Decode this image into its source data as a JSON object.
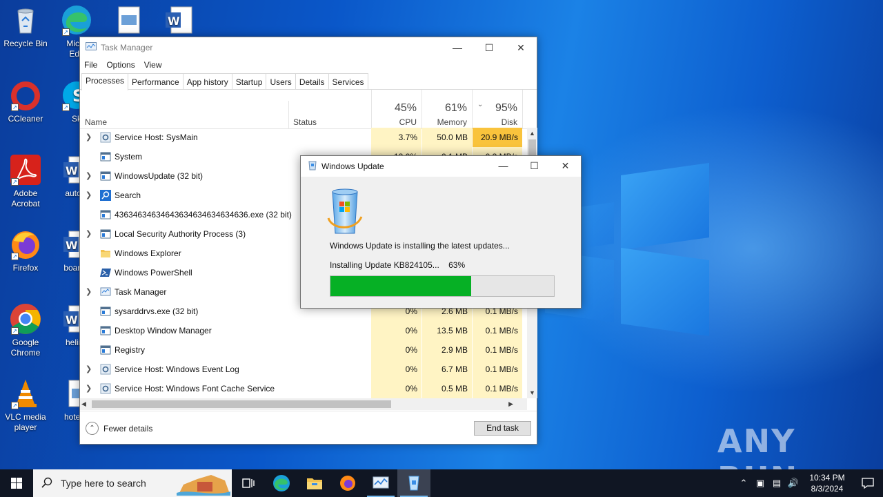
{
  "desktop": {
    "icons": [
      {
        "label": "Recycle Bin",
        "icon": "recycle-bin-icon"
      },
      {
        "label": "Micro Edg",
        "icon": "edge-icon"
      },
      {
        "label": "CCleaner",
        "icon": "ccleaner-icon"
      },
      {
        "label": "Sky",
        "icon": "skype-icon"
      },
      {
        "label": "Adobe Acrobat",
        "icon": "acrobat-icon"
      },
      {
        "label": "autom",
        "icon": "word-doc-icon"
      },
      {
        "label": "Firefox",
        "icon": "firefox-icon"
      },
      {
        "label": "boardp",
        "icon": "word-doc-icon"
      },
      {
        "label": "Google Chrome",
        "icon": "chrome-icon"
      },
      {
        "label": "helinu",
        "icon": "word-doc-icon"
      },
      {
        "label": "VLC media player",
        "icon": "vlc-icon"
      },
      {
        "label": "hotelte",
        "icon": "image-file-icon"
      }
    ],
    "watermark": "ANY RUN"
  },
  "task_manager": {
    "title": "Task Manager",
    "menu": [
      "File",
      "Options",
      "View"
    ],
    "tabs": [
      "Processes",
      "Performance",
      "App history",
      "Startup",
      "Users",
      "Details",
      "Services"
    ],
    "active_tab": "Processes",
    "columns": {
      "name": "Name",
      "status": "Status",
      "cpu_pct": "45%",
      "cpu": "CPU",
      "mem_pct": "61%",
      "mem": "Memory",
      "disk_pct": "95%",
      "disk": "Disk"
    },
    "processes": [
      {
        "name": "Service Host: SysMain",
        "expand": true,
        "icon": "gear-icon",
        "cpu": "3.7%",
        "mem": "50.0 MB",
        "disk": "20.9 MB/s",
        "disk_hot": true
      },
      {
        "name": "System",
        "expand": false,
        "icon": "window-icon",
        "cpu": "13.0%",
        "mem": "0.1 MB",
        "disk": "0.3 MB/s"
      },
      {
        "name": "WindowsUpdate (32 bit)",
        "expand": true,
        "icon": "window-icon",
        "cpu": "",
        "mem": "",
        "disk": ""
      },
      {
        "name": "Search",
        "expand": true,
        "icon": "search-icon",
        "cpu": "",
        "mem": "",
        "disk": ""
      },
      {
        "name": "43634634634643634634634634636.exe (32 bit)",
        "expand": false,
        "icon": "window-icon",
        "cpu": "",
        "mem": "",
        "disk": ""
      },
      {
        "name": "Local Security Authority Process (3)",
        "expand": true,
        "icon": "window-icon",
        "cpu": "",
        "mem": "",
        "disk": ""
      },
      {
        "name": "Windows Explorer",
        "expand": false,
        "icon": "folder-icon",
        "cpu": "",
        "mem": "",
        "disk": ""
      },
      {
        "name": "Windows PowerShell",
        "expand": false,
        "icon": "powershell-icon",
        "cpu": "",
        "mem": "",
        "disk": ""
      },
      {
        "name": "Task Manager",
        "expand": true,
        "icon": "task-manager-icon",
        "cpu": "",
        "mem": "",
        "disk": ""
      },
      {
        "name": "sysarddrvs.exe (32 bit)",
        "expand": false,
        "icon": "window-icon",
        "cpu": "0%",
        "mem": "2.6 MB",
        "disk": "0.1 MB/s"
      },
      {
        "name": "Desktop Window Manager",
        "expand": false,
        "icon": "window-icon",
        "cpu": "0%",
        "mem": "13.5 MB",
        "disk": "0.1 MB/s"
      },
      {
        "name": "Registry",
        "expand": false,
        "icon": "window-icon",
        "cpu": "0%",
        "mem": "2.9 MB",
        "disk": "0.1 MB/s"
      },
      {
        "name": "Service Host: Windows Event Log",
        "expand": true,
        "icon": "gear-icon",
        "cpu": "0%",
        "mem": "6.7 MB",
        "disk": "0.1 MB/s"
      },
      {
        "name": "Service Host: Windows Font Cache Service",
        "expand": true,
        "icon": "gear-icon",
        "cpu": "0%",
        "mem": "0.5 MB",
        "disk": "0.1 MB/s"
      }
    ],
    "fewer_details": "Fewer details",
    "end_task": "End task"
  },
  "windows_update": {
    "title": "Windows Update",
    "message": "Windows Update is installing the latest updates...",
    "status": "Installing Update KB824105...",
    "percent_label": "63%",
    "progress": 0.63,
    "progress_color": "#06b025"
  },
  "taskbar": {
    "search_placeholder": "Type here to search",
    "time": "10:34 PM",
    "date": "8/3/2024"
  }
}
